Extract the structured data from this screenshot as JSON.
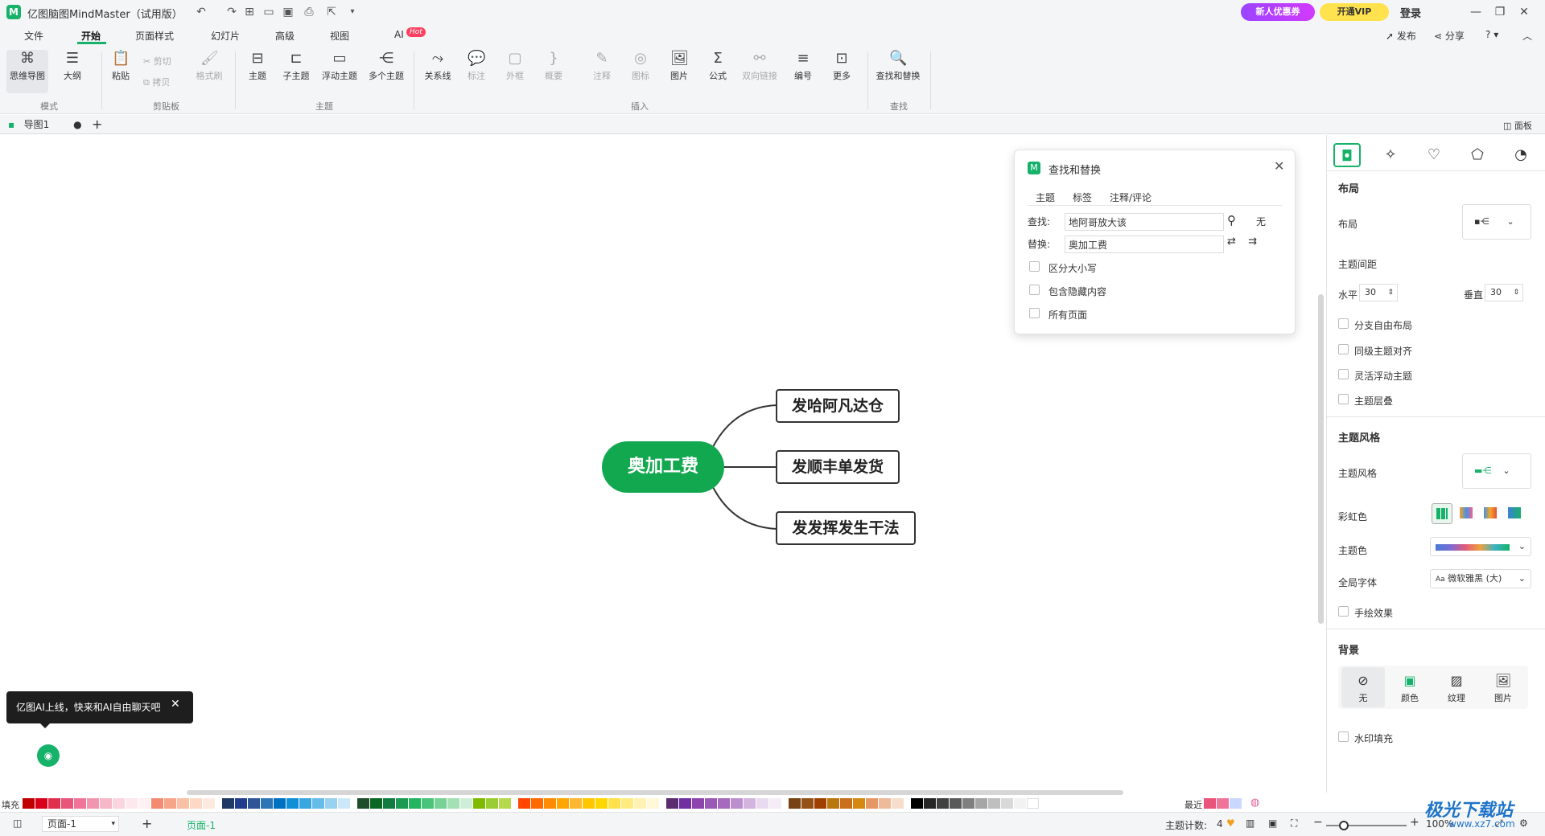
{
  "app": {
    "title": "亿图脑图MindMaster（试用版）",
    "promo_label": "新人优惠券",
    "vip_label": "开通VIP",
    "login_label": "登录"
  },
  "menu": {
    "tabs": [
      "文件",
      "开始",
      "页面样式",
      "幻灯片",
      "高级",
      "视图",
      "AI"
    ],
    "active": "开始",
    "hot_badge": "Hot",
    "publish": "发布",
    "share": "分享",
    "help": "?"
  },
  "ribbon": {
    "mindmap": "思维导图",
    "outline": "大纲",
    "mode_group": "模式",
    "paste": "粘贴",
    "cut": "剪切",
    "copy": "拷贝",
    "format_painter": "格式刷",
    "clipboard_group": "剪贴板",
    "topic": "主题",
    "subtopic": "子主题",
    "floating_topic": "浮动主题",
    "multi_topic": "多个主题",
    "topic_group": "主题",
    "relation": "关系线",
    "callout": "标注",
    "boundary": "外框",
    "summary": "概要",
    "note": "注释",
    "icon": "图标",
    "image": "图片",
    "formula": "公式",
    "bilink": "双向链接",
    "number": "编号",
    "more": "更多",
    "insert_group": "插入",
    "find_replace": "查找和替换",
    "find_group": "查找"
  },
  "document": {
    "tab_name": "导图1",
    "panel_toggle": "面板"
  },
  "mindmap": {
    "root": "奥加工费",
    "children": [
      "发哈阿凡达仓",
      "发顺丰单发货",
      "发发挥发生干法"
    ]
  },
  "find_dialog": {
    "title": "查找和替换",
    "tabs": [
      "主题",
      "标签",
      "注释/评论"
    ],
    "find_label": "查找:",
    "find_value": "地阿哥放大该",
    "find_result": "无",
    "replace_label": "替换:",
    "replace_value": "奥加工费",
    "options": [
      "区分大小写",
      "包含隐藏内容",
      "所有页面"
    ]
  },
  "right_panel": {
    "layout_heading": "布局",
    "layout_label": "布局",
    "spacing_label": "主题间距",
    "horizontal_label": "水平",
    "horizontal_value": "30",
    "vertical_label": "垂直",
    "vertical_value": "30",
    "checks1": [
      "分支自由布局",
      "同级主题对齐",
      "灵活浮动主题",
      "主题层叠"
    ],
    "style_heading": "主题风格",
    "style_label": "主题风格",
    "rainbow_label": "彩虹色",
    "theme_color_label": "主题色",
    "font_label": "全局字体",
    "font_value": "微软雅黑 (大)",
    "font_prefix": "Aa",
    "hand_drawn": "手绘效果",
    "bg_heading": "背景",
    "bg_options": [
      "无",
      "颜色",
      "纹理",
      "图片"
    ],
    "watermark_fill": "水印填充"
  },
  "palette": {
    "fill_label": "填充",
    "recent_label": "最近",
    "colors": [
      "#c00000",
      "#d9001b",
      "#e0304e",
      "#e9547a",
      "#f07499",
      "#f295b1",
      "#f6b7c8",
      "#fad4de",
      "#fde8ed",
      "#fff0f3",
      "#f58a73",
      "#f7a589",
      "#fac0a5",
      "#fcd8c5",
      "#fdeadf",
      "#1f3864",
      "#203c8c",
      "#2f5597",
      "#2e75b6",
      "#0070c0",
      "#0f8fd6",
      "#39a6e0",
      "#66bbe8",
      "#99d1f0",
      "#cce7f7",
      "#1e4d2b",
      "#0b6623",
      "#107c41",
      "#1a9a52",
      "#23b45f",
      "#4cc37a",
      "#78d195",
      "#a3e0b3",
      "#cfeeda",
      "#7fba00",
      "#9acd32",
      "#b5d84e",
      "#ff4500",
      "#ff6a00",
      "#ff8c00",
      "#ffa500",
      "#ffb733",
      "#ffc700",
      "#ffd700",
      "#ffe14d",
      "#ffeb80",
      "#fff2b3",
      "#fff8d9",
      "#5b2c6f",
      "#7030a0",
      "#8e44ad",
      "#9b59b6",
      "#a569bd",
      "#bb8fce",
      "#d2b4de",
      "#e8daef",
      "#f4ecf7",
      "#784212",
      "#935116",
      "#a04000",
      "#b9770e",
      "#ca6f1e",
      "#d68910",
      "#e59866",
      "#edbb99",
      "#f6ddcc",
      "#000000",
      "#262626",
      "#404040",
      "#595959",
      "#7f7f7f",
      "#a6a6a6",
      "#bfbfbf",
      "#d9d9d9",
      "#f2f2f2",
      "#ffffff"
    ],
    "recent": [
      "#e9547a",
      "#f07499",
      "#c8d8ff"
    ]
  },
  "status": {
    "page_select": "页面-1",
    "page_tab": "页面-1",
    "topic_count_label": "主题计数:",
    "topic_count": "4",
    "zoom": "100%"
  },
  "ai_tip": {
    "text": "亿图AI上线，快来和AI自由聊天吧"
  },
  "watermark": {
    "text": "极光下载站",
    "url_text": "www.xz7.com"
  }
}
